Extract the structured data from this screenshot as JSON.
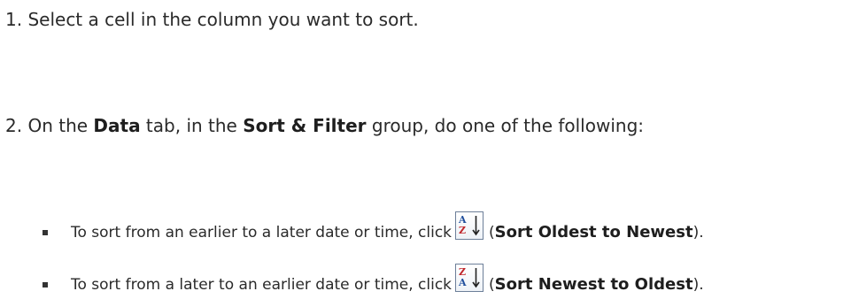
{
  "steps": [
    {
      "number": "1.",
      "text": "Select a cell in the column you want to sort."
    },
    {
      "number": "2.",
      "pre": "On the ",
      "bold1": "Data",
      "mid1": " tab, in the ",
      "bold2": "Sort & Filter",
      "post": " group, do one of the following:"
    }
  ],
  "bullets": [
    {
      "pre": "To sort from an earlier to a later date or time, click ",
      "icon": "sort-a-to-z-icon",
      "icon_top_letter": "A",
      "icon_bottom_letter": "Z",
      "open_paren": " (",
      "bold": "Sort Oldest to Newest",
      "close_paren": ")."
    },
    {
      "pre": "To sort from a later to an earlier date or time, click ",
      "icon": "sort-z-to-a-icon",
      "icon_top_letter": "Z",
      "icon_bottom_letter": "A",
      "open_paren": " (",
      "bold": "Sort Newest to Oldest",
      "close_paren": ")."
    }
  ],
  "colors": {
    "letter_blue": "#1f4e9c",
    "letter_red": "#c0262b",
    "icon_border": "#6d7f99"
  }
}
